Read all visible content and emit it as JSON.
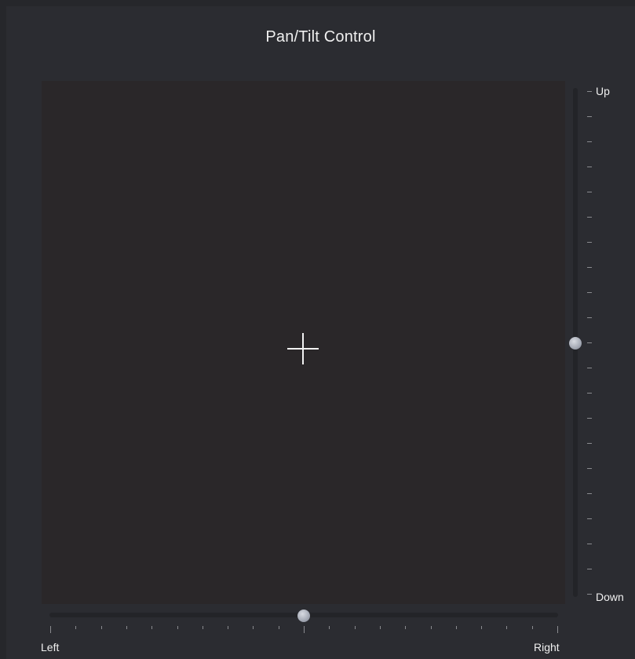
{
  "title": "Pan/Tilt Control",
  "tilt": {
    "top_label": "Up",
    "bottom_label": "Down",
    "position": 0.5,
    "tick_count": 21
  },
  "pan": {
    "left_label": "Left",
    "right_label": "Right",
    "position": 0.5,
    "tick_count": 21
  },
  "colors": {
    "background": "#2b2c31",
    "pad": "#2a2729",
    "track": "#232428",
    "text": "#f0f0f0",
    "thumb": "#a8adb8"
  }
}
